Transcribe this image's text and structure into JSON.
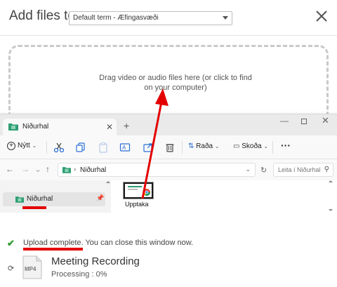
{
  "dialog": {
    "title": "Add files to",
    "term_select_value": "Default term - Æfingasvæði",
    "close_icon": "close-icon"
  },
  "dropzone": {
    "text_line1": "Drag video or audio files here (or click to find",
    "text_line2": "on your computer)"
  },
  "explorer": {
    "tab_label": "Niðurhal",
    "toolbar": {
      "new_label": "Nýtt",
      "sort_label": "Raða",
      "view_label": "Skoða",
      "more": "···"
    },
    "address": {
      "path_label": "Niðurhal",
      "search_placeholder": "Leita í Niðurhal"
    },
    "nav_pane": {
      "selected_item": "Niðurhal"
    },
    "files": [
      {
        "name": "Upptaka"
      }
    ],
    "folder_color": "#2f9e73"
  },
  "upload": {
    "status_link": "Upload complete",
    "status_rest": ". You can close this window now.",
    "file_badge": "MP4",
    "file_title": "Meeting Recording",
    "processing": "Processing : 0%",
    "processing_value": 0
  },
  "colors": {
    "annotation_red": "#e30000",
    "success_green": "#2e9b2e"
  }
}
